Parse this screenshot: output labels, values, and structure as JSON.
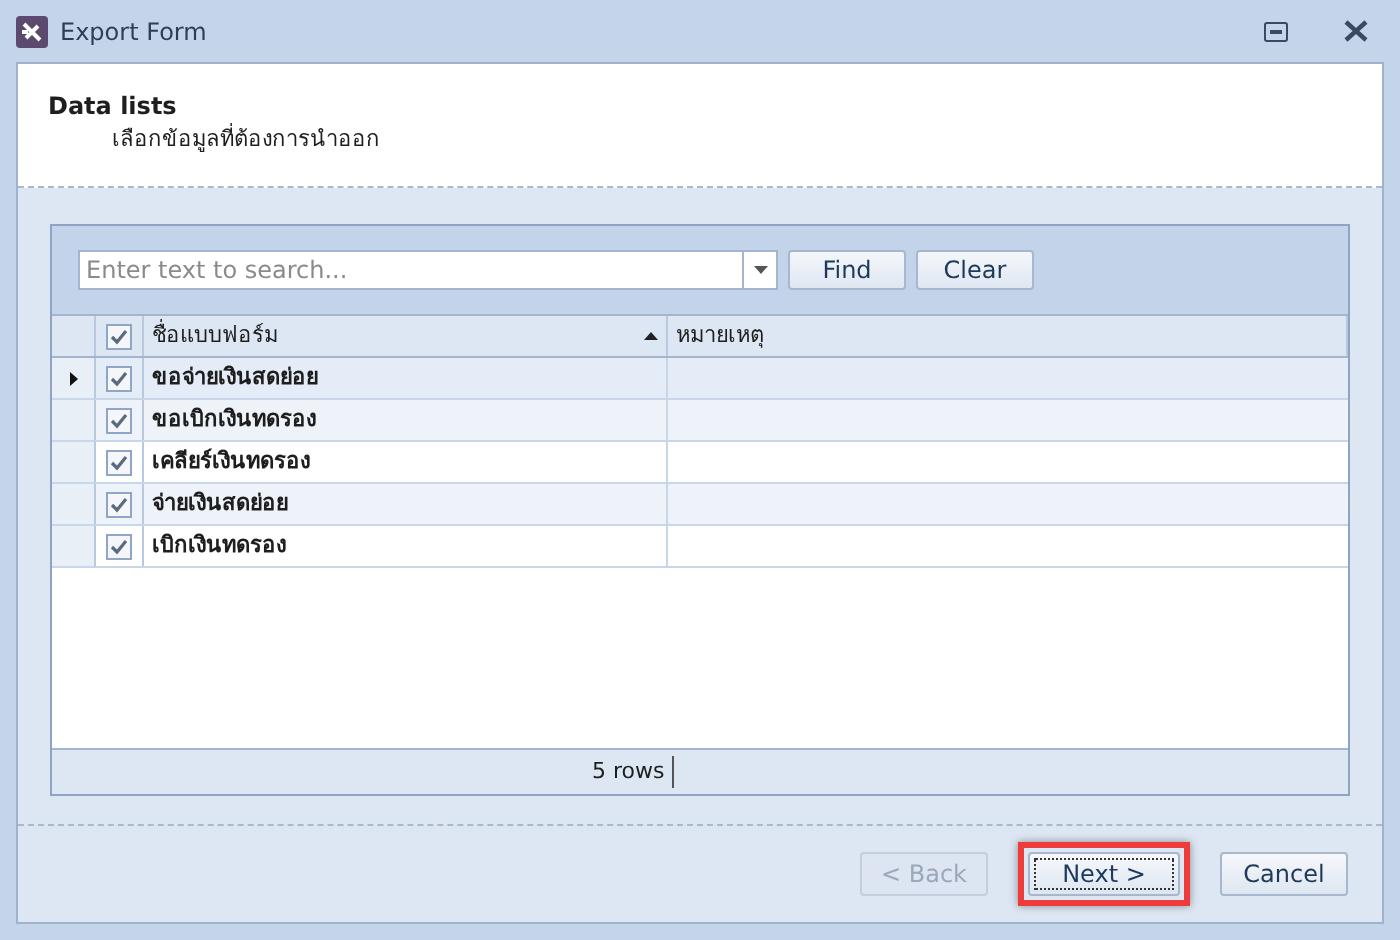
{
  "window": {
    "title": "Export Form"
  },
  "header": {
    "title": "Data lists",
    "subtitle": "เลือกข้อมูลที่ต้องการนำออก"
  },
  "search": {
    "placeholder": "Enter text to search..."
  },
  "toolbar_buttons": [
    "Find",
    "Clear"
  ],
  "table": {
    "header_checked": true,
    "columns": [
      {
        "label": "ชื่อแบบฟอร์ม",
        "sorted": true
      },
      {
        "label": "หมายเหตุ",
        "sorted": false
      }
    ],
    "rows": [
      {
        "name": "ขอจ่ายเงินสดย่อย",
        "checked": true,
        "selected": true
      },
      {
        "name": "ขอเบิกเงินทดรอง",
        "checked": true,
        "selected": false
      },
      {
        "name": "เคลียร์เงินทดรอง",
        "checked": true,
        "selected": false
      },
      {
        "name": "จ่ายเงินสดย่อย",
        "checked": true,
        "selected": false
      },
      {
        "name": "เบิกเงินทดรอง",
        "checked": true,
        "selected": false
      }
    ],
    "footer": "5 rows"
  },
  "buttons": [
    {
      "label": "< Back",
      "disabled": true,
      "highlighted": false
    },
    {
      "label": "Next >",
      "disabled": false,
      "highlighted": true
    },
    {
      "label": "Cancel",
      "disabled": false,
      "highlighted": false
    }
  ]
}
